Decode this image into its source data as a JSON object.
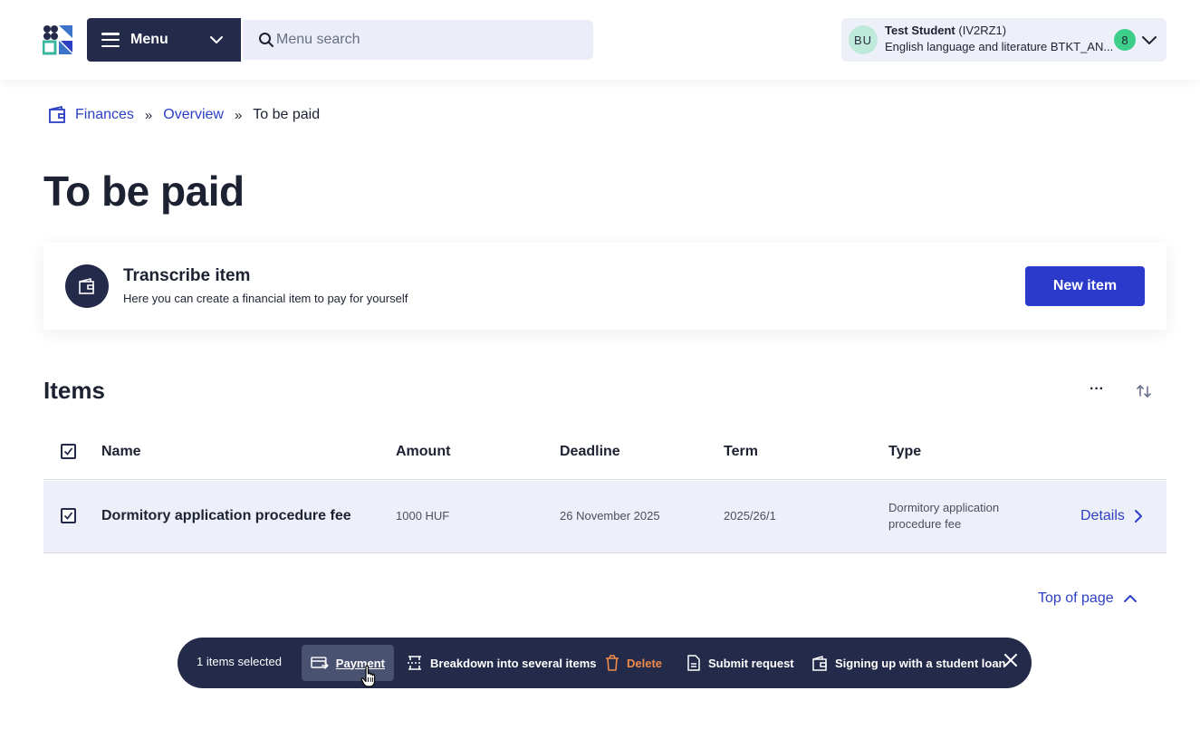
{
  "header": {
    "menu_label": "Menu",
    "search_placeholder": "Menu search",
    "user": {
      "initials": "BU",
      "name": "Test Student",
      "code": "(IV2RZ1)",
      "program": "English language and literature BTKT_AN...",
      "notification_count": "8"
    }
  },
  "breadcrumb": {
    "items": [
      "Finances",
      "Overview",
      "To be paid"
    ],
    "separator": "»"
  },
  "page_title": "To be paid",
  "transcribe_card": {
    "title": "Transcribe item",
    "description": "Here you can create a financial item to pay for yourself",
    "button_label": "New item"
  },
  "items": {
    "title": "Items",
    "more_label": "···",
    "columns": [
      "Name",
      "Amount",
      "Deadline",
      "Term",
      "Type"
    ],
    "rows": [
      {
        "name": "Dormitory application procedure fee",
        "amount": "1000 HUF",
        "deadline": "26 November 2025",
        "term": "2025/26/1",
        "type_line1": "Dormitory application",
        "type_line2": "procedure fee",
        "details_label": "Details"
      }
    ],
    "top_of_page_label": "Top of page"
  },
  "action_bar": {
    "selected_text": "1 items selected",
    "payment": "Payment",
    "breakdown": "Breakdown into several items",
    "delete": "Delete",
    "submit_request": "Submit request",
    "student_loan": "Signing up with a student loan"
  },
  "colors": {
    "navy": "#232a4a",
    "link_blue": "#2c3fc4",
    "primary_button": "#2b3acb",
    "row_highlight": "#eef0f9",
    "badge_green": "#3dcf8a",
    "delete_orange": "#f08a4b"
  }
}
